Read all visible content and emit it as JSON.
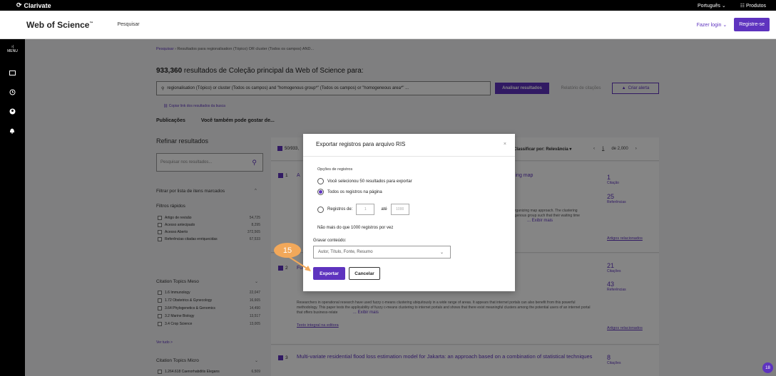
{
  "topbar": {
    "brand": "Clarivate",
    "language": "Português ⌄",
    "products": "☷ Produtos"
  },
  "header": {
    "product": "Web of Science",
    "tm": "™",
    "search": "Pesquisar",
    "login": "Fazer login ⌄",
    "register": "Registre-se"
  },
  "sidebar": {
    "menu_line1": "›|",
    "menu_line2": "MENU"
  },
  "breadcrumb": {
    "link": "Pesquisar",
    "sep": "›",
    "text": "Resultados para regionalisation (Tópico) OR cluster (Todos os campos) AND..."
  },
  "results": {
    "count": "933,360",
    "title_rest": " resultados de Coleção principal da Web of Science para:",
    "query": "regionalisation (Tópico) or cluster (Todos os campos) and \"homogenous group*\" (Todos os campos) or \"homogeneous area*\" ...",
    "analyze": "Analisar resultados",
    "report": "Relatório de citações",
    "alert": "Criar alerta",
    "copy_link": "Copiar link dos resultados da busca",
    "tab_pubs": "Publicações",
    "tab_also": "Você também pode gostar de..."
  },
  "refine": {
    "title": "Refinar resultados",
    "placeholder": "Pesquisar nos resultados...",
    "marked_list": "Filtrar por lista de itens marcados",
    "quick_filters": "Filtros rápidos",
    "quick": [
      {
        "label": "Artigo de revisão",
        "count": "54,725"
      },
      {
        "label": "Acesso antecipado",
        "count": "8,295"
      },
      {
        "label": "Acesso Aberto",
        "count": "372,565"
      },
      {
        "label": "Referências citadas enriquecidas",
        "count": "67,533"
      }
    ],
    "meso_title": "Citation Topics Meso",
    "meso": [
      {
        "label": "1.6 Immunology",
        "count": "22,047"
      },
      {
        "label": "1.72 Obstetrics & Gynecology",
        "count": "16,665"
      },
      {
        "label": "3.64 Phylogenetics & Genomics",
        "count": "14,490"
      },
      {
        "label": "3.2 Marine Biology",
        "count": "13,517"
      },
      {
        "label": "3.4 Crop Science",
        "count": "13,005"
      }
    ],
    "see_all": "Ver tudo >",
    "micro_title": "Citation Topics Micro",
    "micro": [
      {
        "label": "1.264.618 Caenorhabditis Elegans",
        "count": "6,509"
      }
    ]
  },
  "results_bar": {
    "selected": "50/933,",
    "sort": "Classificar por: Relevância ▾",
    "prev": "‹",
    "page": "1",
    "of": "de 2,000",
    "next": "›"
  },
  "records": [
    {
      "num": "1",
      "title_start": "A",
      "title_end": "zing map",
      "abstract_end": "organizing map approach. The clustering",
      "abstract_end2": "ogenous group such that their waiting time",
      "more": "... Exibir mais",
      "cit": "1",
      "cit_label": "Citação",
      "ref": "25",
      "ref_label": "Referências",
      "related": "Artigos relacionados"
    },
    {
      "num": "2",
      "title_start": "Fu",
      "abstract": "Researchers in operational research have used fuzzy c-means clustering ubiquitously in a wide range of areas. It appears that internet portals can also benefit from this powerful methodology. This paper tests the applicability of fuzzy c-means clustering to internet portals and shows that there exist meaningful clusters among the potential users of an internet portal that offers business-relate",
      "more": "... Exibir mais",
      "fulltext": "Texto integral na editora",
      "cit": "21",
      "cit_label": "Citações",
      "ref": "43",
      "ref_label": "Referências",
      "related": "Artigos relacionados"
    },
    {
      "num": "3",
      "title": "Multi-variate residential flood loss estimation model for Jakarta: an approach based on a combination of statistical techniques",
      "cit": "8",
      "cit_label": "Citações"
    }
  ],
  "modal": {
    "title": "Exportar registros para arquivo RIS",
    "close": "×",
    "options_label": "Opções de registros",
    "opt1": "Você selecionou 50 resultados para exportar",
    "opt2": "Todos os registros na página",
    "opt3": "Registros de:",
    "from": "1",
    "to_label": "até",
    "to": "1000",
    "limit": "Não mais do que 1000 registros por vez",
    "content_label": "Gravar conteúdo:",
    "content_value": "Autor, Título, Fonte, Resumo",
    "export": "Exportar",
    "cancel": "Cancelar"
  },
  "step": "15",
  "help_badge": "18",
  "colors": {
    "accent": "#5e33bf",
    "step": "#f2a85a"
  }
}
